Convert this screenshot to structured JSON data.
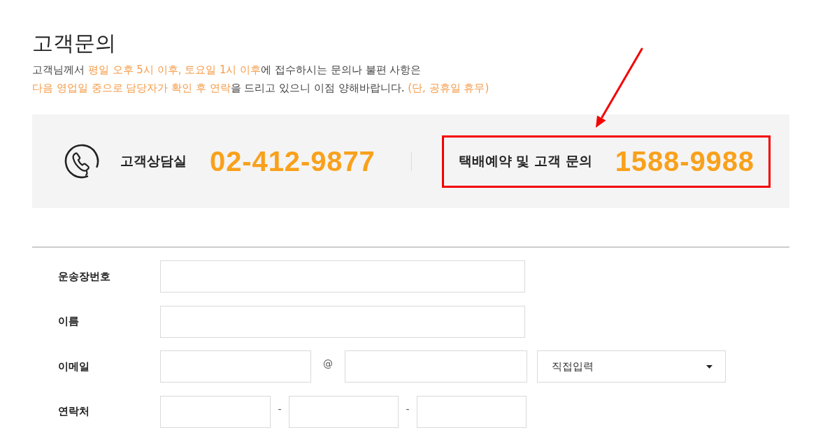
{
  "header": {
    "title": "고객문의",
    "notice": [
      [
        {
          "text": "고객님께서 ",
          "highlight": false
        },
        {
          "text": "평일 오후 5시 이후, 토요일 1시 이후",
          "highlight": true
        },
        {
          "text": "에 접수하시는 문의나 불편 사항은",
          "highlight": false
        }
      ],
      [
        {
          "text": "다음 영업일 중으로 담당자가 확인 후 연락",
          "highlight": true
        },
        {
          "text": "을 드리고 있으니 이점 양해바랍니다. ",
          "highlight": false
        },
        {
          "text": "(단, 공휴일 휴무)",
          "highlight": true
        }
      ]
    ]
  },
  "contacts": [
    {
      "kind": "main",
      "label": "고객상담실",
      "number": "02-412-9877",
      "highlighted": false
    },
    {
      "kind": "extra",
      "label": "택배예약 및 고객 문의",
      "number": "1588-9988",
      "highlighted": true
    }
  ],
  "form": {
    "rows": [
      {
        "label": "운송장번호",
        "kind": "single",
        "parts": [
          {
            "kind": "input"
          }
        ]
      },
      {
        "label": "이름",
        "kind": "single",
        "parts": [
          {
            "kind": "input"
          }
        ]
      },
      {
        "label": "이메일",
        "kind": "email",
        "parts": [
          {
            "kind": "input"
          },
          {
            "kind": "separator",
            "text": "@"
          },
          {
            "kind": "input"
          },
          {
            "kind": "select",
            "value": "직접입력"
          }
        ]
      },
      {
        "label": "연락처",
        "kind": "phone",
        "parts": [
          {
            "kind": "input"
          },
          {
            "kind": "separator",
            "text": "-"
          },
          {
            "kind": "input"
          },
          {
            "kind": "separator",
            "text": "-"
          },
          {
            "kind": "input"
          }
        ]
      }
    ]
  }
}
